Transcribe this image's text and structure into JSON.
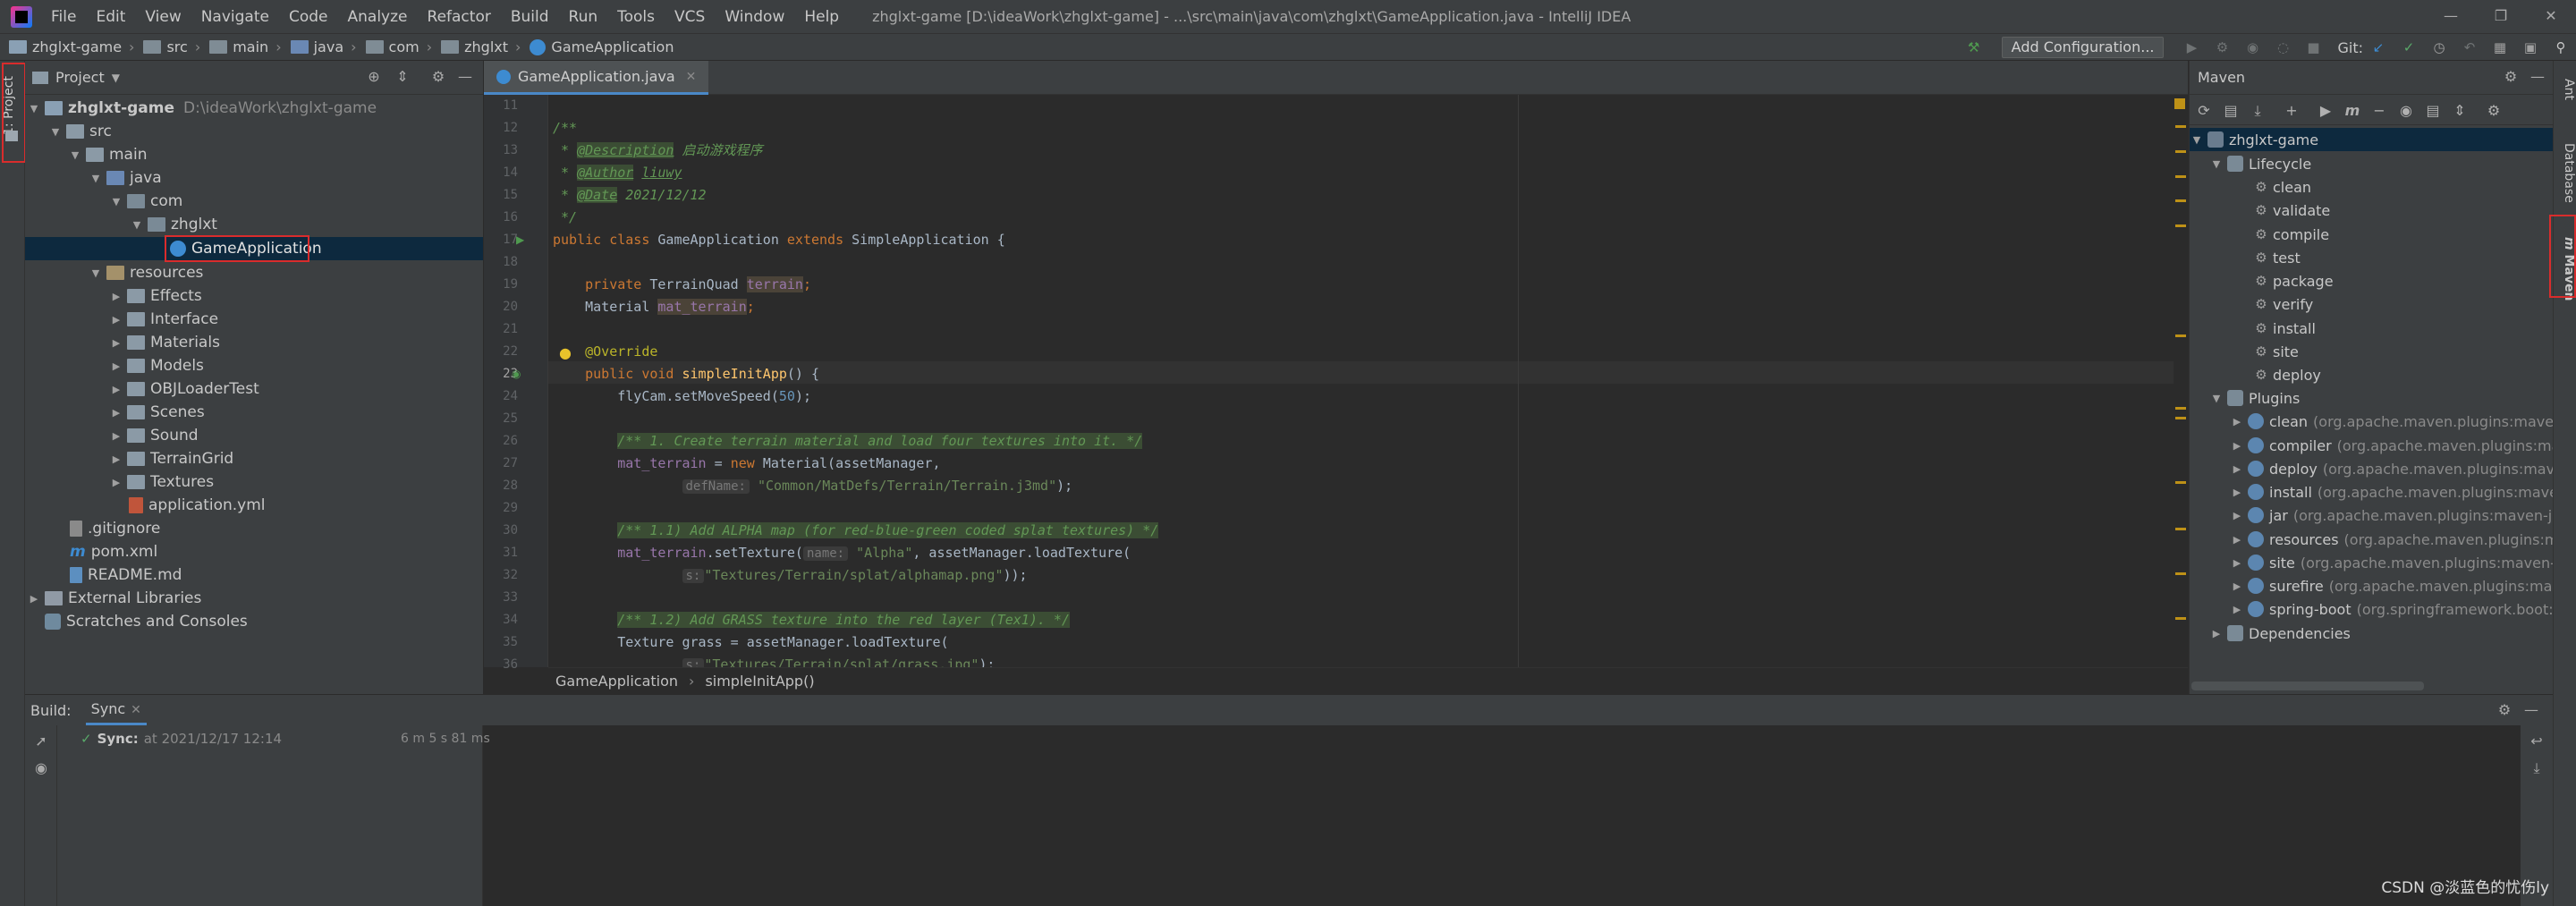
{
  "menubar": {
    "items": [
      "File",
      "Edit",
      "View",
      "Navigate",
      "Code",
      "Analyze",
      "Refactor",
      "Build",
      "Run",
      "Tools",
      "VCS",
      "Window",
      "Help"
    ],
    "title": "zhglxt-game [D:\\ideaWork\\zhglxt-game] - ...\\src\\main\\java\\com\\zhglxt\\GameApplication.java - IntelliJ IDEA"
  },
  "navbar": {
    "crumbs": [
      "zhglxt-game",
      "src",
      "main",
      "java",
      "com",
      "zhglxt",
      "GameApplication"
    ],
    "add_config": "Add Configuration...",
    "git_label": "Git:"
  },
  "leftstrip": {
    "project_tab": "1: Project"
  },
  "project": {
    "header": "Project",
    "tree": [
      {
        "label": "zhglxt-game",
        "path": "D:\\ideaWork\\zhglxt-game"
      },
      {
        "label": "src"
      },
      {
        "label": "main"
      },
      {
        "label": "java"
      },
      {
        "label": "com"
      },
      {
        "label": "zhglxt"
      },
      {
        "label": "GameApplication"
      },
      {
        "label": "resources"
      },
      {
        "label": "Effects"
      },
      {
        "label": "Interface"
      },
      {
        "label": "Materials"
      },
      {
        "label": "Models"
      },
      {
        "label": "OBJLoaderTest"
      },
      {
        "label": "Scenes"
      },
      {
        "label": "Sound"
      },
      {
        "label": "TerrainGrid"
      },
      {
        "label": "Textures"
      },
      {
        "label": "application.yml"
      },
      {
        "label": ".gitignore"
      },
      {
        "label": "pom.xml"
      },
      {
        "label": "README.md"
      },
      {
        "label": "External Libraries"
      },
      {
        "label": "Scratches and Consoles"
      }
    ]
  },
  "editor": {
    "tab": "GameApplication.java",
    "line_numbers": [
      "11",
      "12",
      "13",
      "14",
      "15",
      "16",
      "17",
      "18",
      "19",
      "20",
      "21",
      "22",
      "23",
      "24",
      "25",
      "26",
      "27",
      "28",
      "29",
      "30",
      "31",
      "32",
      "33",
      "34",
      "35",
      "36"
    ],
    "comment_open": "/**",
    "desc_tag": "@Description",
    "desc_text": "启动游戏程序",
    "author_tag": "@Author",
    "author_text": "liuwy",
    "date_tag": "@Date",
    "date_text": "2021/12/12",
    "comment_close": "*/",
    "l17_kw1": "public",
    "l17_kw2": "class",
    "l17_name": "GameApplication",
    "l17_kw3": "extends",
    "l17_super": "SimpleApplication {",
    "l19_kw": "private",
    "l19_type": "TerrainQuad",
    "l19_field": "terrain",
    "l20_type": "Material",
    "l20_field": "mat_terrain",
    "l22_ann": "@Override",
    "l23_kw1": "public",
    "l23_kw2": "void",
    "l23_fn": "simpleInitApp",
    "l23_rest": "() {",
    "l24_obj": "flyCam.setMoveSpeed(",
    "l24_num": "50",
    "l24_end": ");",
    "l26_cm": "/** 1. Create terrain material and load four textures into it. */",
    "l27_field": "mat_terrain",
    "l27_kw": "new",
    "l27_rest": "Material(assetManager,",
    "l28_hint": "defName:",
    "l28_str": "\"Common/MatDefs/Terrain/Terrain.j3md\"",
    "l28_end": ");",
    "l30_cm": "/** 1.1) Add ALPHA map (for red-blue-green coded splat textures) */",
    "l31_field": "mat_terrain",
    "l31_call": ".setTexture(",
    "l31_hint": "name:",
    "l31_str": "\"Alpha\"",
    "l31_rest": ", assetManager.loadTexture(",
    "l32_hint": "s:",
    "l32_str": "\"Textures/Terrain/splat/alphamap.png\"",
    "l32_end": "));",
    "l34_cm": "/** 1.2) Add GRASS texture into the red layer (Tex1). */",
    "l35_type": "Texture grass = assetManager.loadTexture(",
    "l36_hint": "s:",
    "l36_str": "\"Textures/Terrain/splat/grass.jpg\"",
    "l36_end": ");",
    "breadcrumb": [
      "GameApplication",
      "simpleInitApp()"
    ]
  },
  "maven": {
    "header": "Maven",
    "project": "zhglxt-game",
    "lifecycle_label": "Lifecycle",
    "lifecycle": [
      "clean",
      "validate",
      "compile",
      "test",
      "package",
      "verify",
      "install",
      "site",
      "deploy"
    ],
    "plugins_label": "Plugins",
    "plugins": [
      {
        "name": "clean",
        "desc": "(org.apache.maven.plugins:maven-cle"
      },
      {
        "name": "compiler",
        "desc": "(org.apache.maven.plugins:maven"
      },
      {
        "name": "deploy",
        "desc": "(org.apache.maven.plugins:maven-d"
      },
      {
        "name": "install",
        "desc": "(org.apache.maven.plugins:maven-in"
      },
      {
        "name": "jar",
        "desc": "(org.apache.maven.plugins:maven-jar-pl"
      },
      {
        "name": "resources",
        "desc": "(org.apache.maven.plugins:mave"
      },
      {
        "name": "site",
        "desc": "(org.apache.maven.plugins:maven-site-"
      },
      {
        "name": "surefire",
        "desc": "(org.apache.maven.plugins:maven-"
      },
      {
        "name": "spring-boot",
        "desc": "(org.springframework.boot:sp"
      }
    ],
    "dependencies_label": "Dependencies"
  },
  "rightstrip": {
    "ant": "Ant",
    "database": "Database",
    "maven": "Maven",
    "maven_m": "m"
  },
  "build": {
    "label": "Build:",
    "tab": "Sync",
    "status_label": "Sync:",
    "status_time": "at 2021/12/17 12:14",
    "duration": "6 m 5 s 81 ms"
  },
  "watermark": "CSDN @淡蓝色的忧伤ly"
}
